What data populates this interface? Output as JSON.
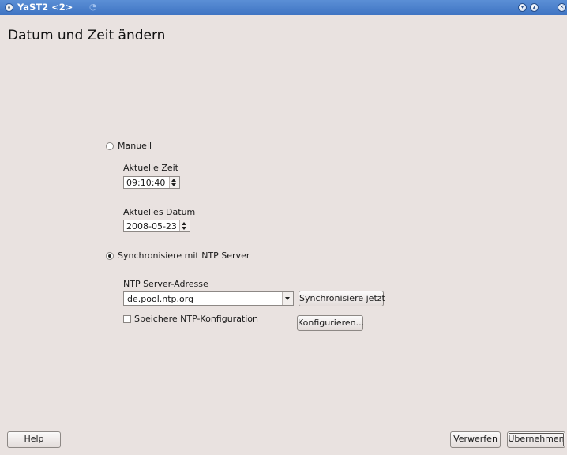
{
  "window": {
    "title": "YaST2 <2>",
    "controls": [
      "minimize-icon",
      "maximize-icon",
      "close-icon"
    ]
  },
  "page_title": "Datum und Zeit ändern",
  "manual": {
    "radio_label": "Manuell",
    "selected": false,
    "time_label": "Aktuelle Zeit",
    "time_value": "09:10:40",
    "date_label": "Aktuelles Datum",
    "date_value": "2008-05-23"
  },
  "ntp": {
    "radio_label": "Synchronisiere mit NTP Server",
    "selected": true,
    "server_label": "NTP Server-Adresse",
    "server_value": "de.pool.ntp.org",
    "sync_button": "Synchronisiere jetzt",
    "save_checkbox_label": "Speichere NTP-Konfiguration",
    "save_checked": false,
    "configure_button": "Konfigurieren..."
  },
  "footer": {
    "help": "Help",
    "discard": "Verwerfen",
    "apply": "Übernehmen"
  }
}
